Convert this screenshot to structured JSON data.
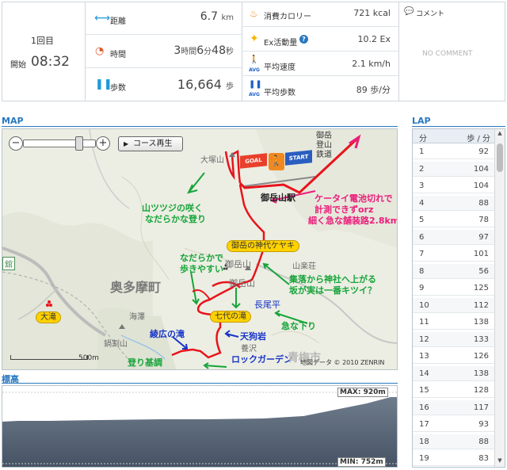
{
  "summary": {
    "count": "1回目",
    "start_label": "開始",
    "start_time": "08:32",
    "distance": {
      "label": "距離",
      "value": "6.7",
      "unit": "km"
    },
    "time": {
      "label": "時間",
      "h": "3",
      "h_unit": "時間",
      "m": "6",
      "m_unit": "分",
      "s": "48",
      "s_unit": "秒"
    },
    "steps": {
      "label": "歩数",
      "value": "16,664",
      "unit": "歩"
    },
    "calorie": {
      "label": "消費カロリー",
      "value": "721 kcal"
    },
    "ex": {
      "label": "Ex活動量",
      "help": "?",
      "value": "10.2 Ex"
    },
    "speed": {
      "label": "平均速度",
      "value": "2.1 km/h"
    },
    "pace": {
      "label": "平均歩数",
      "value": "89 歩/分"
    },
    "comment": {
      "label": "コメント",
      "empty": "NO COMMENT"
    },
    "avg_badge": "AVG"
  },
  "map": {
    "title": "MAP",
    "play_label": "コース再生",
    "zoom_minus": "−",
    "zoom_plus": "+",
    "scale": "500m",
    "copyright": "地図データ © 2010 ZENRIN",
    "goal_flag": "GOAL",
    "start_flag": "START",
    "place_labels": {
      "otakeyama": "大塚山",
      "station": "御岳山駅",
      "railway": "御岳登山鉄道",
      "keyaki": "御岳の神代ケヤキ",
      "sansoso": "山楽荘",
      "mitakesan": "御岳山",
      "okutama": "奥多摩町",
      "nagaodaira": "長尾平",
      "nanayo": "七代の滝",
      "tengu": "天狗岩",
      "ayahiro": "綾広の滝",
      "rock": "ロックガーデン",
      "otaki": "大滝",
      "kaisawa": "海澤",
      "nabewari": "鍋割山",
      "yosawa": "養沢",
      "kan": "舘",
      "aoume": "青梅市"
    },
    "notes": {
      "tsutsuji_1": "山ツツジの咲く",
      "tsutsuji_2": "なだらかな登り",
      "keitai_1": "ケータイ電池切れで",
      "keitai_2": "計測できずorz",
      "keitai_3": "細く急な舗装路2.8km",
      "nadaraka_1": "なだらかで",
      "nadaraka_2": "歩きやすい",
      "jinja_1": "集落から神社へ上がる",
      "jinja_2": "坂が実は一番キツイ？",
      "kyuu": "急な下り",
      "nobori": "登り基調"
    }
  },
  "elevation": {
    "title": "標高",
    "max_label": "MAX: 920m",
    "min_label": "MIN: 752m",
    "max_m": 920,
    "min_m": 752
  },
  "lap": {
    "title": "LAP",
    "col_min": "分",
    "col_pace": "歩 / 分",
    "rows": [
      [
        "1",
        "92"
      ],
      [
        "2",
        "104"
      ],
      [
        "3",
        "104"
      ],
      [
        "4",
        "88"
      ],
      [
        "5",
        "78"
      ],
      [
        "6",
        "97"
      ],
      [
        "7",
        "101"
      ],
      [
        "8",
        "56"
      ],
      [
        "9",
        "125"
      ],
      [
        "10",
        "112"
      ],
      [
        "11",
        "138"
      ],
      [
        "12",
        "133"
      ],
      [
        "13",
        "126"
      ],
      [
        "14",
        "138"
      ],
      [
        "15",
        "128"
      ],
      [
        "16",
        "117"
      ],
      [
        "17",
        "93"
      ],
      [
        "18",
        "88"
      ],
      [
        "19",
        "83"
      ]
    ]
  },
  "colors": {
    "accent": "#2878c0",
    "route": "#e8141c",
    "note_green": "#17a43a",
    "note_pink": "#ea1e7a",
    "tag": "#ffd200"
  }
}
